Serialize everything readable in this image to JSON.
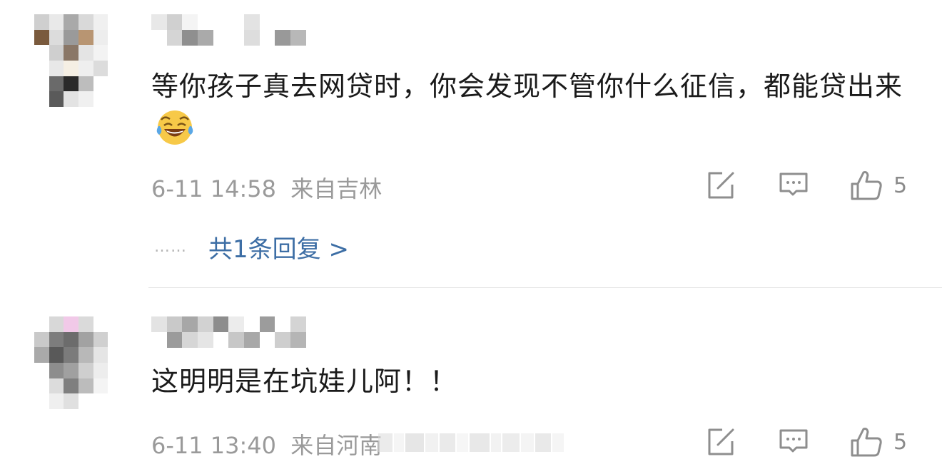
{
  "comments": [
    {
      "text": "等你孩子真去网贷时，你会发现不管你什么征信，都能贷出来",
      "emoji": "tears-of-joy",
      "date": "6-11 14:58",
      "location": "来自吉林",
      "likes": "5",
      "replies_link": "共1条回复 >",
      "replies_dots": "……"
    },
    {
      "text": "这明明是在坑娃儿阿！！",
      "date": "6-11 13:40",
      "location": "来自河南",
      "likes": "5"
    }
  ],
  "colors": {
    "text": "#1a1a1a",
    "meta": "#9a9a9a",
    "link": "#3d6ea5",
    "divider": "#e6e6e6"
  },
  "icons": [
    "share-icon",
    "comment-icon",
    "like-icon"
  ]
}
